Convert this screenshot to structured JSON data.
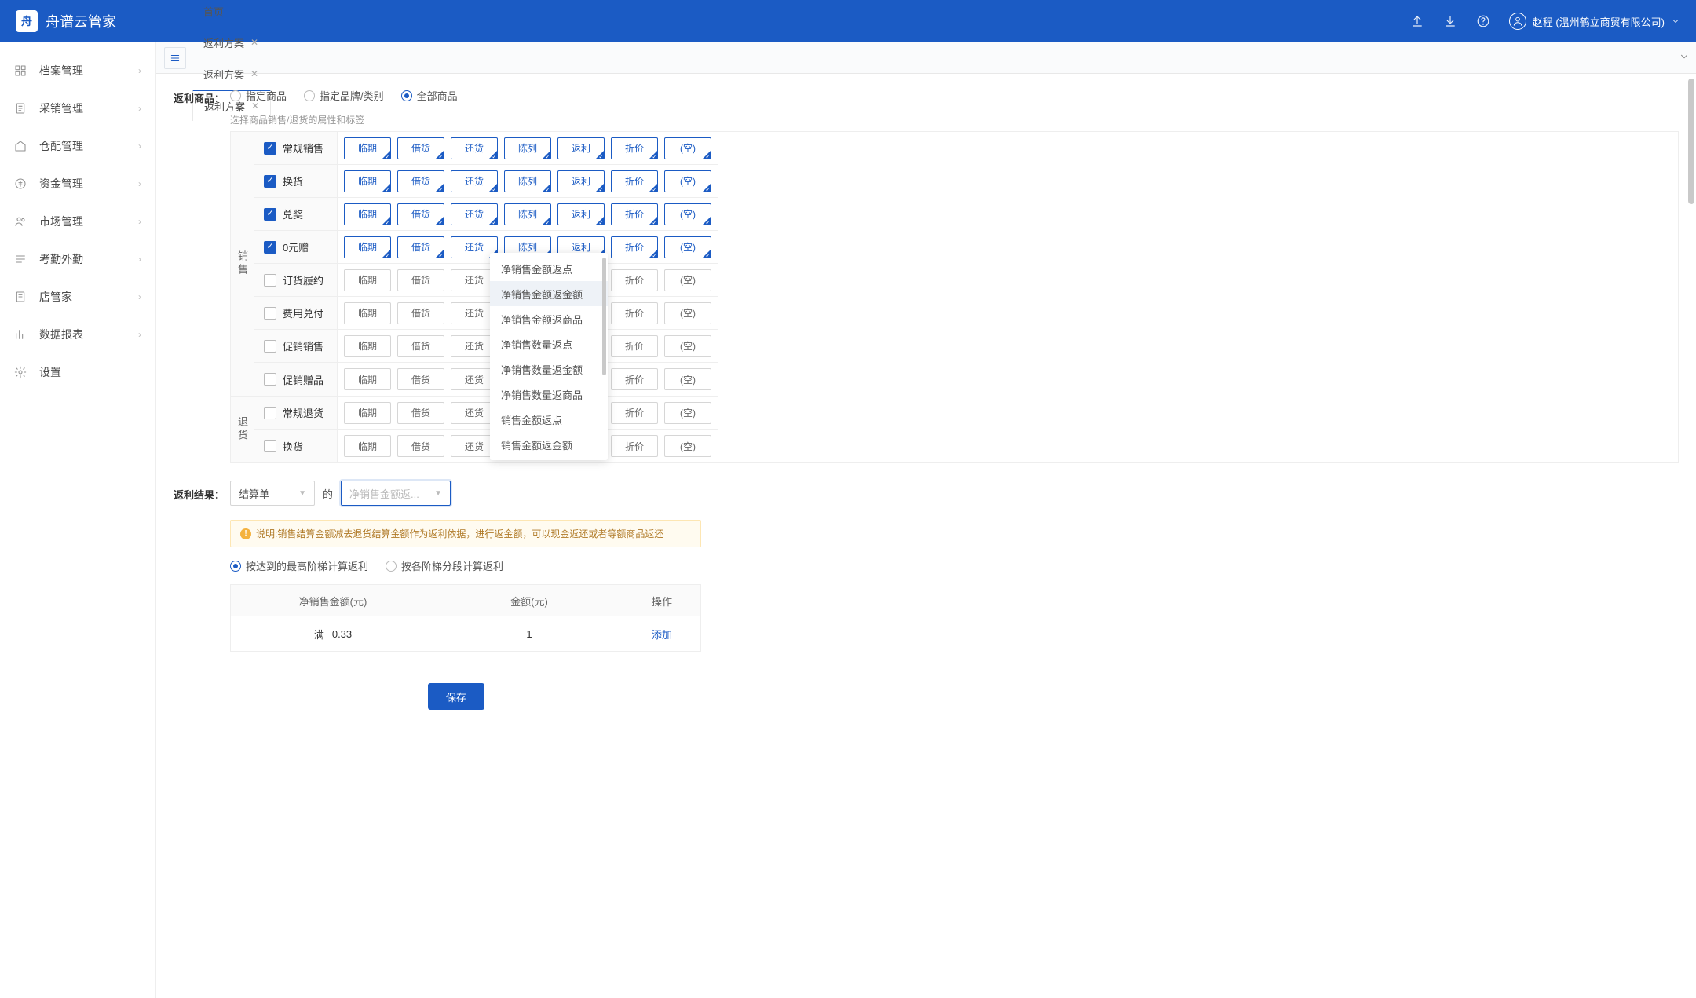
{
  "header": {
    "app_title": "舟谱云管家",
    "user_name": "赵程 (温州鹤立商贸有限公司)"
  },
  "sidebar": {
    "items": [
      {
        "label": "档案管理"
      },
      {
        "label": "采销管理"
      },
      {
        "label": "仓配管理"
      },
      {
        "label": "资金管理"
      },
      {
        "label": "市场管理"
      },
      {
        "label": "考勤外勤"
      },
      {
        "label": "店管家"
      },
      {
        "label": "数据报表"
      },
      {
        "label": "设置"
      }
    ]
  },
  "tabs": {
    "items": [
      {
        "label": "首页",
        "closable": false
      },
      {
        "label": "返利方案",
        "closable": true
      },
      {
        "label": "返利方案",
        "closable": true
      },
      {
        "label": "返利方案",
        "closable": true,
        "active": true
      }
    ]
  },
  "form": {
    "goods_label": "返利商品：",
    "goods_options": [
      "指定商品",
      "指定品牌/类别",
      "全部商品"
    ],
    "goods_selected": 2,
    "attr_hint": "选择商品销售/退货的属性和标签",
    "group_sale": "销售",
    "group_return": "退货",
    "tags": [
      "临期",
      "借货",
      "还货",
      "陈列",
      "返利",
      "折价",
      "(空)"
    ],
    "sale_rows": [
      {
        "label": "常规销售",
        "checked": true
      },
      {
        "label": "换货",
        "checked": true
      },
      {
        "label": "兑奖",
        "checked": true
      },
      {
        "label": "0元赠",
        "checked": true
      },
      {
        "label": "订货履约",
        "checked": false
      },
      {
        "label": "费用兑付",
        "checked": false
      },
      {
        "label": "促销销售",
        "checked": false
      },
      {
        "label": "促销赠品",
        "checked": false
      }
    ],
    "return_rows": [
      {
        "label": "常规退货",
        "checked": false
      },
      {
        "label": "换货",
        "checked": false
      }
    ],
    "result_label": "返利结果：",
    "select1_value": "结算单",
    "between_text": "的",
    "select2_placeholder": "净销售金额返...",
    "dropdown_items": [
      "净销售金额返点",
      "净销售金额返金额",
      "净销售金额返商品",
      "净销售数量返点",
      "净销售数量返金额",
      "净销售数量返商品",
      "销售金额返点",
      "销售金额返金额"
    ],
    "dropdown_selected": 1,
    "notice_text": "说明:销售结算金额减去退货结算金额作为返利依据，进行返金额，可以现金返还或者等额商品返还",
    "calc_options": [
      "按达到的最高阶梯计算返利",
      "按各阶梯分段计算返利"
    ],
    "calc_selected": 0,
    "tier_headers": [
      "净销售金额(元)",
      "金额(元)",
      "操作"
    ],
    "tier_row": {
      "prefix": "满",
      "v1": "0.33",
      "v2": "1",
      "action": "添加"
    },
    "save_btn": "保存"
  }
}
